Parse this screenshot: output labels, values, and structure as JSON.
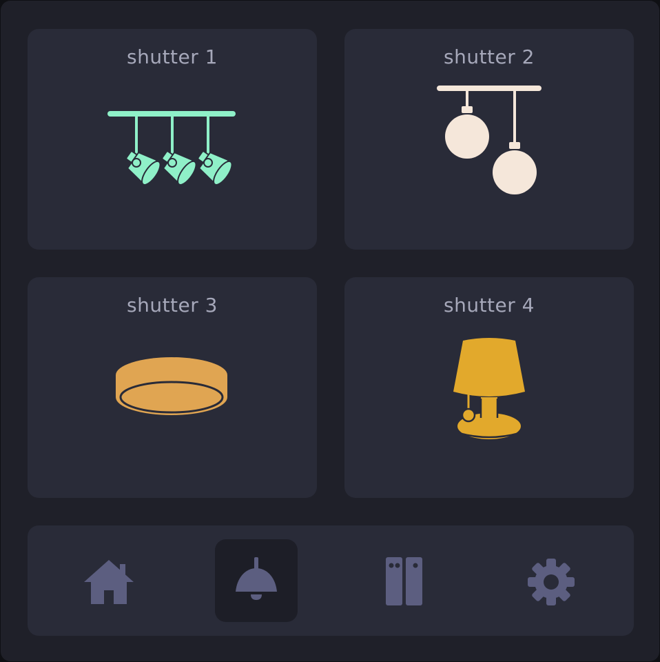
{
  "devices": [
    {
      "label": "shutter 1",
      "icon": "track-spotlight-icon",
      "color": "#8ff0c8"
    },
    {
      "label": "shutter 2",
      "icon": "pendant-globe-lights-icon",
      "color": "#f5e7da"
    },
    {
      "label": "shutter 3",
      "icon": "ceiling-flush-light-icon",
      "color": "#e0a552"
    },
    {
      "label": "shutter 4",
      "icon": "table-lamp-icon",
      "color": "#e2a92c"
    }
  ],
  "nav": {
    "items": [
      {
        "name": "home",
        "icon": "home-icon",
        "active": false
      },
      {
        "name": "lights",
        "icon": "ceiling-lamp-icon",
        "active": true
      },
      {
        "name": "shutters",
        "icon": "shutter-doors-icon",
        "active": false
      },
      {
        "name": "settings",
        "icon": "gear-icon",
        "active": false
      }
    ],
    "icon_color": "#5c5e80"
  }
}
